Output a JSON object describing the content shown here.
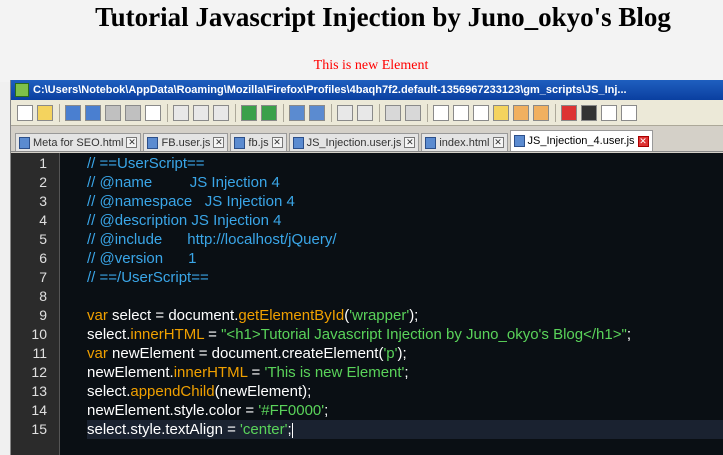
{
  "page": {
    "title": "Tutorial Javascript Injection by Juno_okyo's Blog",
    "new_element_text": "This is new Element",
    "new_element_color": "#FF0000"
  },
  "window": {
    "title": "C:\\Users\\Notebok\\AppData\\Roaming\\Mozilla\\Firefox\\Profiles\\4baqh7f2.default-1356967233123\\gm_scripts\\JS_Inj..."
  },
  "toolbar": {
    "buttons": [
      "new-file-icon",
      "open-file-icon",
      "save-icon",
      "save-all-icon",
      "close-icon",
      "close-all-icon",
      "print-icon",
      "cut-icon",
      "copy-icon",
      "paste-icon",
      "undo-icon",
      "redo-icon",
      "find-icon",
      "replace-icon",
      "zoom-in-icon",
      "zoom-out-icon",
      "sync-v-icon",
      "sync-h-icon",
      "wrap-icon",
      "show-all-chars-icon",
      "indent-guide-icon",
      "udl-icon",
      "doc-map-icon",
      "function-list-icon",
      "record-macro-icon",
      "stop-macro-icon",
      "play-macro-icon",
      "run-macro-icon"
    ]
  },
  "tabs": [
    {
      "label": "Meta for SEO.html",
      "active": false
    },
    {
      "label": "FB.user.js",
      "active": false
    },
    {
      "label": "fb.js",
      "active": false
    },
    {
      "label": "JS_Injection.user.js",
      "active": false
    },
    {
      "label": "index.html",
      "active": false
    },
    {
      "label": "JS_Injection_4.user.js",
      "active": true
    }
  ],
  "colors": {
    "comment": "#3aa6e8",
    "keyword": "#f0a000",
    "string": "#5ad35a",
    "editor_bg": "#0a0f14"
  },
  "lines": [
    {
      "n": "1",
      "t": "// ==UserScript=="
    },
    {
      "n": "2",
      "t": "// @name         JS Injection 4"
    },
    {
      "n": "3",
      "t": "// @namespace   JS Injection 4"
    },
    {
      "n": "4",
      "t": "// @description JS Injection 4"
    },
    {
      "n": "5",
      "t": "// @include      http://localhost/jQuery/"
    },
    {
      "n": "6",
      "t": "// @version      1"
    },
    {
      "n": "7",
      "t": "// ==/UserScript=="
    },
    {
      "n": "8",
      "t": ""
    },
    {
      "n": "9",
      "t": "var select = document.getElementById('wrapper');"
    },
    {
      "n": "10",
      "t": "select.innerHTML = \"<h1>Tutorial Javascript Injection by Juno_okyo's Blog</h1>\";"
    },
    {
      "n": "11",
      "t": "var newElement = document.createElement('p');"
    },
    {
      "n": "12",
      "t": "newElement.innerHTML = 'This is new Element';"
    },
    {
      "n": "13",
      "t": "select.appendChild(newElement);"
    },
    {
      "n": "14",
      "t": "newElement.style.color = '#FF0000';"
    },
    {
      "n": "15",
      "t": "select.style.textAlign = 'center';"
    }
  ]
}
